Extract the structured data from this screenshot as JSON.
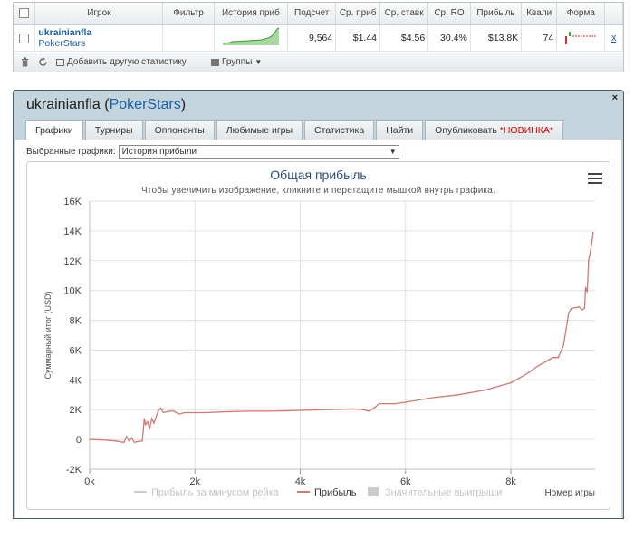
{
  "stats": {
    "headers": [
      "Игрок",
      "Фильтр",
      "История приб",
      "Подсчет",
      "Ср. приб",
      "Ср. ставк",
      "Ср. RO",
      "Прибыль",
      "Квали",
      "Форма"
    ],
    "row": {
      "player_name": "ukrainianfla",
      "player_site": "PokerStars",
      "count": "9,564",
      "avg_profit": "$1.44",
      "avg_stake": "$4.56",
      "avg_roi": "30.4%",
      "profit": "$13.8K",
      "ability": "74",
      "remove": "x"
    },
    "toolbar": {
      "add_stats_label": "Добавить другую статистику",
      "groups_label": "Группы"
    }
  },
  "panel": {
    "player_name": "ukrainianfla",
    "site_name": "PokerStars",
    "close": "×",
    "tabs": [
      {
        "label": "Графики"
      },
      {
        "label": "Турниры"
      },
      {
        "label": "Оппоненты"
      },
      {
        "label": "Любимые игры"
      },
      {
        "label": "Статистика"
      },
      {
        "label": "Найти"
      },
      {
        "label": "Опубликовать",
        "badge": "*НОВИНКА*"
      }
    ],
    "chart_select_label": "Выбранные графики:",
    "chart_select_value": "История прибыли"
  },
  "colors": {
    "profit_line": "#cd7a73",
    "sparkline": "#3b9a3b",
    "accent_blue": "#1a5ea8",
    "new_badge": "#dd0000"
  },
  "chart_data": {
    "type": "line",
    "title": "Общая прибыль",
    "subtitle": "Чтобы увеличить изображение, кликните и перетащите мышкой внутрь графика.",
    "ylabel": "Суммарный итог (USD)",
    "xlabel": "Номер игры",
    "ylim": [
      -2000,
      16000
    ],
    "xlim": [
      0,
      9600
    ],
    "y_ticks": [
      "-2K",
      "0",
      "2K",
      "4K",
      "6K",
      "8K",
      "10K",
      "12K",
      "14K",
      "16K"
    ],
    "x_ticks": [
      "0k",
      "2k",
      "4k",
      "6k",
      "8k"
    ],
    "grid": true,
    "legend_position": "bottom",
    "legend": [
      {
        "name": "Прибыль за минусом рейка",
        "active": false
      },
      {
        "name": "Прибыль",
        "active": true
      },
      {
        "name": "Значительные выигрыши",
        "active": false
      }
    ],
    "series": [
      {
        "name": "Прибыль",
        "x": [
          0,
          300,
          500,
          650,
          700,
          750,
          800,
          850,
          900,
          1000,
          1040,
          1060,
          1100,
          1140,
          1180,
          1220,
          1300,
          1350,
          1400,
          1500,
          1600,
          1700,
          1800,
          1900,
          2000,
          2200,
          2500,
          3000,
          3500,
          4000,
          4500,
          5000,
          5200,
          5300,
          5400,
          5500,
          5800,
          6000,
          6500,
          7000,
          7500,
          7800,
          8000,
          8300,
          8500,
          8700,
          8800,
          8900,
          9000,
          9050,
          9100,
          9150,
          9300,
          9350,
          9400,
          9420,
          9450,
          9480,
          9500,
          9530,
          9564
        ],
        "y": [
          0,
          -50,
          -100,
          -200,
          200,
          -100,
          100,
          -200,
          -150,
          -100,
          1400,
          1000,
          1200,
          700,
          1400,
          1100,
          1900,
          2100,
          1800,
          1900,
          1900,
          1700,
          1800,
          1800,
          1800,
          1800,
          1850,
          1900,
          1900,
          1950,
          2000,
          2050,
          2000,
          1900,
          2100,
          2400,
          2400,
          2500,
          2800,
          3000,
          3300,
          3600,
          3800,
          4400,
          4900,
          5300,
          5500,
          5500,
          6300,
          7400,
          8500,
          8800,
          8900,
          8700,
          8800,
          10200,
          9900,
          12100,
          12400,
          13000,
          13900
        ]
      }
    ]
  }
}
